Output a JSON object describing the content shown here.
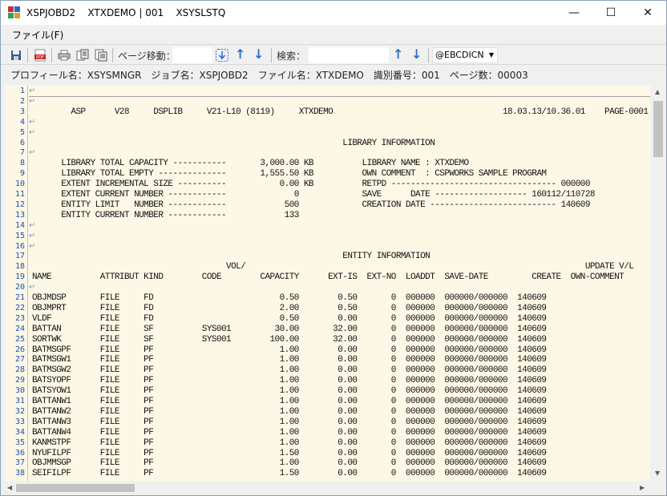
{
  "window": {
    "title": "XSPJOBD2    XTXDEMO | 001    XSYSLSTQ",
    "minimize": "—",
    "maximize": "☐",
    "close": "✕"
  },
  "menu": {
    "file": "ファイル(F)"
  },
  "toolbar": {
    "page_move_label": "ページ移動：",
    "search_label": "検索：",
    "encoding": "@EBCDICN",
    "colors": {
      "arrow": "#2a6fd6",
      "pdf": "#d42020"
    }
  },
  "info": {
    "profile": "プロフィール名：XSYSMNGR",
    "job": "ジョブ名：XSPJOBD2",
    "file": "ファイル名：XTXDEMO",
    "id": "識別番号：001",
    "pages": "ページ数：00003"
  },
  "listing": {
    "line_numbers": [
      "1",
      "2",
      "3",
      "4",
      "5",
      "6",
      "7",
      "8",
      "9",
      "10",
      "11",
      "12",
      "13",
      "14",
      "15",
      "16",
      "17",
      "18",
      "19",
      "20",
      "21",
      "22",
      "23",
      "24",
      "25",
      "26",
      "27",
      "28",
      "29",
      "30",
      "31",
      "32",
      "33",
      "34",
      "35",
      "36",
      "37",
      "38"
    ],
    "lines": [
      "",
      "",
      "        ASP      V28     DSPLIB     V21-L10 (8119)     XTXDEMO                                   18.03.13/10.36.01    PAGE-0001",
      "",
      "",
      "                                                                LIBRARY INFORMATION",
      "",
      "      LIBRARY TOTAL CAPACITY -----------       3,000.00 KB          LIBRARY NAME : XTXDEMO",
      "      LIBRARY TOTAL EMPTY --------------       1,555.50 KB          OWN COMMENT  : CSPWORKS SAMPLE PROGRAM",
      "      EXTENT INCREMENTAL SIZE ----------           0.00 KB          RETPD ---------------------------------- 000000",
      "      EXTENT CURRENT NUMBER ------------              0             SAVE      DATE ------------------- 160112/110728",
      "      ENTITY LIMIT   NUMBER ------------            500             CREATION DATE -------------------------- 140609",
      "      ENTITY CURRENT NUMBER ------------            133",
      "",
      "",
      "",
      "                                                                ENTITY INFORMATION",
      "                                        VOL/                                                                      UPDATE V/L    TYPE,CODE (MBR)",
      "NAME          ATTRIBUT KIND        CODE        CAPACITY      EXT-IS  EXT-NO  LOADDT  SAVE-DATE         CREATE  OWN-COMMENT",
      "",
      "OBJMDSP       FILE     FD                          0.50        0.50       0  000000  000000/000000  140609",
      "OBJMPRT       FILE     FD                          2.00        0.50       0  000000  000000/000000  140609",
      "VLDF          FILE     FD                          0.50        0.00       0  000000  000000/000000  140609",
      "BATTAN        FILE     SF          SYS001         30.00       32.00       0  000000  000000/000000  140609",
      "SORTWK        FILE     SF          SYS001        100.00       32.00       0  000000  000000/000000  140609",
      "BATMSGPF      FILE     PF                          1.00        0.00       0  000000  000000/000000  140609",
      "BATMSGW1      FILE     PF                          1.00        0.00       0  000000  000000/000000  140609",
      "BATMSGW2      FILE     PF                          1.00        0.00       0  000000  000000/000000  140609",
      "BATSYOPF      FILE     PF                          1.00        0.00       0  000000  000000/000000  140609",
      "BATSYOW1      FILE     PF                          1.00        0.00       0  000000  000000/000000  140609",
      "BATTANW1      FILE     PF                          1.00        0.00       0  000000  000000/000000  140609",
      "BATTANW2      FILE     PF                          1.00        0.00       0  000000  000000/000000  140609",
      "BATTANW3      FILE     PF                          1.00        0.00       0  000000  000000/000000  140609",
      "BATTANW4      FILE     PF                          1.00        0.00       0  000000  000000/000000  140609",
      "KANMSTPF      FILE     PF                          1.00        0.00       0  000000  000000/000000  140609",
      "NYUFILPF      FILE     PF                          1.50        0.00       0  000000  000000/000000  140609",
      "OBJMMSGP      FILE     PF                          1.00        0.00       0  000000  000000/000000  140609",
      "SEIFILPF      FILE     PF                          1.50        0.00       0  000000  000000/000000  140609"
    ],
    "return_mark_lines": [
      1,
      2,
      4,
      5,
      7,
      14,
      15,
      16,
      20
    ]
  }
}
